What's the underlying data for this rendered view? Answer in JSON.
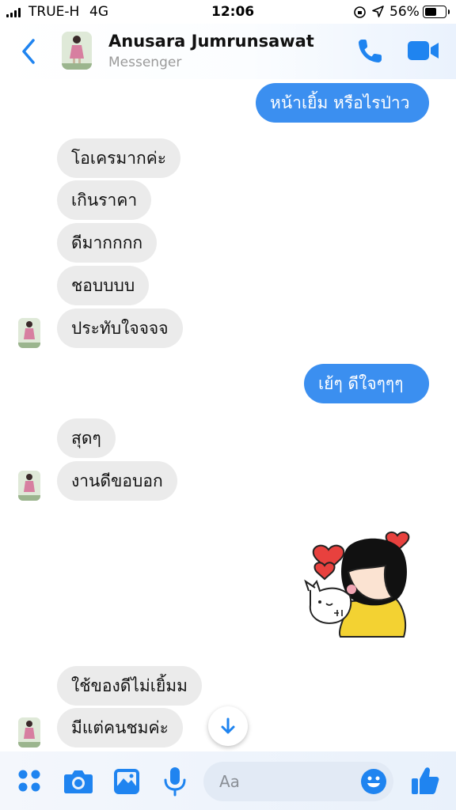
{
  "status_bar": {
    "carrier": "TRUE-H",
    "network": "4G",
    "time": "12:06",
    "battery": "56%"
  },
  "header": {
    "contact_name": "Anusara Jumrunsawat",
    "subtitle": "Messenger"
  },
  "messages": [
    {
      "dir": "out",
      "text": "หน้าเยิ้ม หรือไรป่าว"
    },
    {
      "dir": "in",
      "text": "โอเครมากค่ะ"
    },
    {
      "dir": "in",
      "text": "เกินราคา"
    },
    {
      "dir": "in",
      "text": "ดีมากกกก"
    },
    {
      "dir": "in",
      "text": "ชอบบบบ"
    },
    {
      "dir": "in",
      "text": "ประทับใจจจจ"
    },
    {
      "dir": "out",
      "text": "เย้ๆ ดีใจๆๆๆ"
    },
    {
      "dir": "in",
      "text": "สุดๆ"
    },
    {
      "dir": "in",
      "text": "งานดีขอบอก"
    },
    {
      "dir": "out",
      "sticker": "girl-hugging-cat-hearts"
    },
    {
      "dir": "in",
      "text": "ใช้ของดีไม่เยิ้มม"
    },
    {
      "dir": "in",
      "text": "มีแต่คนชมค่ะ"
    }
  ],
  "composer": {
    "placeholder": "Aa"
  },
  "colors": {
    "accent": "#3b8ff0",
    "incoming_bubble": "#ebebeb"
  }
}
